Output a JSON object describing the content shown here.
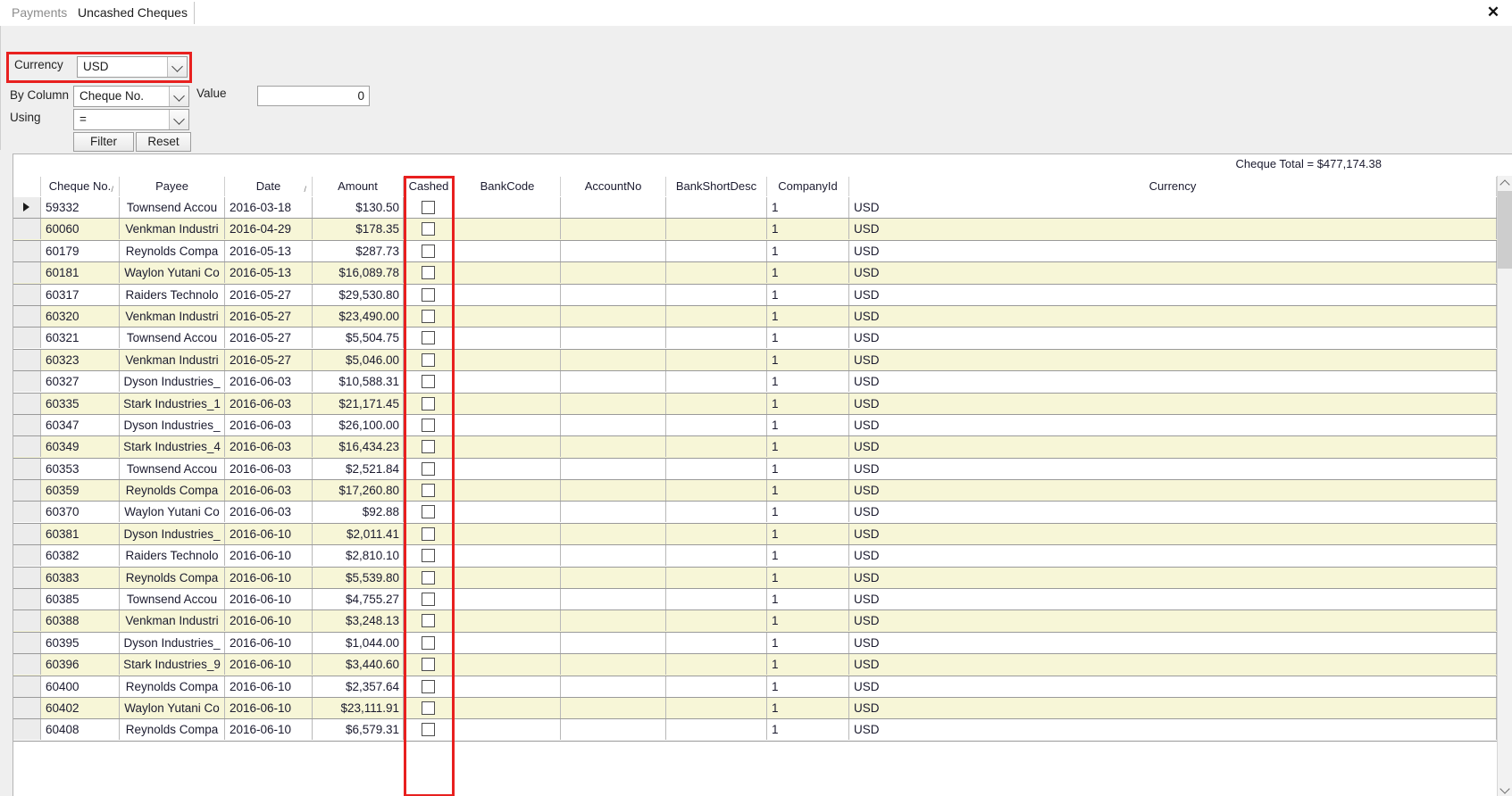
{
  "window": {
    "close_label": "✕"
  },
  "tabs": [
    {
      "label": "Payments",
      "active": false
    },
    {
      "label": "Uncashed Cheques",
      "active": true
    }
  ],
  "filter_panel": {
    "currency_label": "Currency",
    "currency_value": "USD",
    "by_column_label": "By Column",
    "by_column_value": "Cheque No.",
    "using_label": "Using",
    "using_value": "=",
    "value_label": "Value",
    "value_input": "0",
    "filter_button": "Filter",
    "reset_button": "Reset",
    "highlight_color": "#e8201f"
  },
  "grid": {
    "total_label": "Cheque Total = $477,174.38",
    "columns": [
      {
        "key": "cheque_no",
        "label": "Cheque No.",
        "sort": "/"
      },
      {
        "key": "payee",
        "label": "Payee",
        "sort": ""
      },
      {
        "key": "date",
        "label": "Date",
        "sort": "/"
      },
      {
        "key": "amount",
        "label": "Amount",
        "sort": ""
      },
      {
        "key": "cashed",
        "label": "Cashed",
        "sort": ""
      },
      {
        "key": "bank_code",
        "label": "BankCode",
        "sort": ""
      },
      {
        "key": "account_no",
        "label": "AccountNo",
        "sort": ""
      },
      {
        "key": "bank_short_desc",
        "label": "BankShortDesc",
        "sort": ""
      },
      {
        "key": "company_id",
        "label": "CompanyId",
        "sort": ""
      },
      {
        "key": "currency",
        "label": "Currency",
        "sort": ""
      }
    ],
    "rows": [
      {
        "cheque_no": "59332",
        "payee": "Townsend Accou",
        "date": "2016-03-18",
        "amount": "$130.50",
        "cashed": false,
        "bank_code": "",
        "account_no": "",
        "bank_short_desc": "",
        "company_id": "1",
        "currency": "USD",
        "selected": true
      },
      {
        "cheque_no": "60060",
        "payee": "Venkman Industri",
        "date": "2016-04-29",
        "amount": "$178.35",
        "cashed": false,
        "bank_code": "",
        "account_no": "",
        "bank_short_desc": "",
        "company_id": "1",
        "currency": "USD",
        "selected": false
      },
      {
        "cheque_no": "60179",
        "payee": "Reynolds Compa",
        "date": "2016-05-13",
        "amount": "$287.73",
        "cashed": false,
        "bank_code": "",
        "account_no": "",
        "bank_short_desc": "",
        "company_id": "1",
        "currency": "USD",
        "selected": false
      },
      {
        "cheque_no": "60181",
        "payee": "Waylon Yutani Co",
        "date": "2016-05-13",
        "amount": "$16,089.78",
        "cashed": false,
        "bank_code": "",
        "account_no": "",
        "bank_short_desc": "",
        "company_id": "1",
        "currency": "USD",
        "selected": false
      },
      {
        "cheque_no": "60317",
        "payee": "Raiders Technolo",
        "date": "2016-05-27",
        "amount": "$29,530.80",
        "cashed": false,
        "bank_code": "",
        "account_no": "",
        "bank_short_desc": "",
        "company_id": "1",
        "currency": "USD",
        "selected": false
      },
      {
        "cheque_no": "60320",
        "payee": "Venkman Industri",
        "date": "2016-05-27",
        "amount": "$23,490.00",
        "cashed": false,
        "bank_code": "",
        "account_no": "",
        "bank_short_desc": "",
        "company_id": "1",
        "currency": "USD",
        "selected": false
      },
      {
        "cheque_no": "60321",
        "payee": "Townsend Accou",
        "date": "2016-05-27",
        "amount": "$5,504.75",
        "cashed": false,
        "bank_code": "",
        "account_no": "",
        "bank_short_desc": "",
        "company_id": "1",
        "currency": "USD",
        "selected": false
      },
      {
        "cheque_no": "60323",
        "payee": "Venkman Industri",
        "date": "2016-05-27",
        "amount": "$5,046.00",
        "cashed": false,
        "bank_code": "",
        "account_no": "",
        "bank_short_desc": "",
        "company_id": "1",
        "currency": "USD",
        "selected": false
      },
      {
        "cheque_no": "60327",
        "payee": "Dyson Industries_",
        "date": "2016-06-03",
        "amount": "$10,588.31",
        "cashed": false,
        "bank_code": "",
        "account_no": "",
        "bank_short_desc": "",
        "company_id": "1",
        "currency": "USD",
        "selected": false
      },
      {
        "cheque_no": "60335",
        "payee": "Stark Industries_1",
        "date": "2016-06-03",
        "amount": "$21,171.45",
        "cashed": false,
        "bank_code": "",
        "account_no": "",
        "bank_short_desc": "",
        "company_id": "1",
        "currency": "USD",
        "selected": false
      },
      {
        "cheque_no": "60347",
        "payee": "Dyson Industries_",
        "date": "2016-06-03",
        "amount": "$26,100.00",
        "cashed": false,
        "bank_code": "",
        "account_no": "",
        "bank_short_desc": "",
        "company_id": "1",
        "currency": "USD",
        "selected": false
      },
      {
        "cheque_no": "60349",
        "payee": "Stark Industries_4",
        "date": "2016-06-03",
        "amount": "$16,434.23",
        "cashed": false,
        "bank_code": "",
        "account_no": "",
        "bank_short_desc": "",
        "company_id": "1",
        "currency": "USD",
        "selected": false
      },
      {
        "cheque_no": "60353",
        "payee": "Townsend Accou",
        "date": "2016-06-03",
        "amount": "$2,521.84",
        "cashed": false,
        "bank_code": "",
        "account_no": "",
        "bank_short_desc": "",
        "company_id": "1",
        "currency": "USD",
        "selected": false
      },
      {
        "cheque_no": "60359",
        "payee": "Reynolds Compa",
        "date": "2016-06-03",
        "amount": "$17,260.80",
        "cashed": false,
        "bank_code": "",
        "account_no": "",
        "bank_short_desc": "",
        "company_id": "1",
        "currency": "USD",
        "selected": false
      },
      {
        "cheque_no": "60370",
        "payee": "Waylon Yutani Co",
        "date": "2016-06-03",
        "amount": "$92.88",
        "cashed": false,
        "bank_code": "",
        "account_no": "",
        "bank_short_desc": "",
        "company_id": "1",
        "currency": "USD",
        "selected": false
      },
      {
        "cheque_no": "60381",
        "payee": "Dyson Industries_",
        "date": "2016-06-10",
        "amount": "$2,011.41",
        "cashed": false,
        "bank_code": "",
        "account_no": "",
        "bank_short_desc": "",
        "company_id": "1",
        "currency": "USD",
        "selected": false
      },
      {
        "cheque_no": "60382",
        "payee": "Raiders Technolo",
        "date": "2016-06-10",
        "amount": "$2,810.10",
        "cashed": false,
        "bank_code": "",
        "account_no": "",
        "bank_short_desc": "",
        "company_id": "1",
        "currency": "USD",
        "selected": false
      },
      {
        "cheque_no": "60383",
        "payee": "Reynolds Compa",
        "date": "2016-06-10",
        "amount": "$5,539.80",
        "cashed": false,
        "bank_code": "",
        "account_no": "",
        "bank_short_desc": "",
        "company_id": "1",
        "currency": "USD",
        "selected": false
      },
      {
        "cheque_no": "60385",
        "payee": "Townsend Accou",
        "date": "2016-06-10",
        "amount": "$4,755.27",
        "cashed": false,
        "bank_code": "",
        "account_no": "",
        "bank_short_desc": "",
        "company_id": "1",
        "currency": "USD",
        "selected": false
      },
      {
        "cheque_no": "60388",
        "payee": "Venkman Industri",
        "date": "2016-06-10",
        "amount": "$3,248.13",
        "cashed": false,
        "bank_code": "",
        "account_no": "",
        "bank_short_desc": "",
        "company_id": "1",
        "currency": "USD",
        "selected": false
      },
      {
        "cheque_no": "60395",
        "payee": "Dyson Industries_",
        "date": "2016-06-10",
        "amount": "$1,044.00",
        "cashed": false,
        "bank_code": "",
        "account_no": "",
        "bank_short_desc": "",
        "company_id": "1",
        "currency": "USD",
        "selected": false
      },
      {
        "cheque_no": "60396",
        "payee": "Stark Industries_9",
        "date": "2016-06-10",
        "amount": "$3,440.60",
        "cashed": false,
        "bank_code": "",
        "account_no": "",
        "bank_short_desc": "",
        "company_id": "1",
        "currency": "USD",
        "selected": false
      },
      {
        "cheque_no": "60400",
        "payee": "Reynolds Compa",
        "date": "2016-06-10",
        "amount": "$2,357.64",
        "cashed": false,
        "bank_code": "",
        "account_no": "",
        "bank_short_desc": "",
        "company_id": "1",
        "currency": "USD",
        "selected": false
      },
      {
        "cheque_no": "60402",
        "payee": "Waylon Yutani Co",
        "date": "2016-06-10",
        "amount": "$23,111.91",
        "cashed": false,
        "bank_code": "",
        "account_no": "",
        "bank_short_desc": "",
        "company_id": "1",
        "currency": "USD",
        "selected": false
      },
      {
        "cheque_no": "60408",
        "payee": "Reynolds Compa",
        "date": "2016-06-10",
        "amount": "$6,579.31",
        "cashed": false,
        "bank_code": "",
        "account_no": "",
        "bank_short_desc": "",
        "company_id": "1",
        "currency": "USD",
        "selected": false
      }
    ],
    "row_highlight_color": "#e8201f",
    "alt_row_color": "#f7f6d7"
  }
}
